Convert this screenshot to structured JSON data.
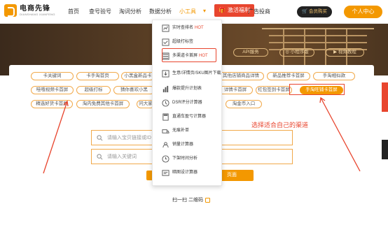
{
  "brand": {
    "name": "电商先锋",
    "sub": "DIANSHANG XIANFENG"
  },
  "nav": {
    "items": [
      "首页",
      "查号验号",
      "淘词分析",
      "数据分析",
      "小工具"
    ],
    "hot_label": "激活福利",
    "ads_label": "广告投商",
    "vip_label": "会员购买",
    "center_label": "个人中心"
  },
  "hero": {
    "buttons": [
      "API服务",
      "小程序版",
      "视频教程"
    ]
  },
  "tags": {
    "row1": [
      "卡关键词",
      "卡手淘首页",
      "小黑盒新品卡",
      "",
      "其他店铺商品详情",
      "新品推荐卡首屏",
      "手淘相似款"
    ],
    "row2": [
      "哇哦视频卡首屏",
      "超级打标",
      "猜你喜欢小黑",
      "",
      "详情卡首屏",
      "红包签到卡首屏",
      "手淘旺铺卡首屏"
    ],
    "row3": [
      "精选好货卡首屏",
      "淘内免费其他卡首屏",
      "问大家",
      "",
      "淘金币入口"
    ]
  },
  "search": {
    "placeholder1": "请输入宝贝链接或ID",
    "placeholder2": "请输入关键词",
    "generate_label": "页面",
    "qr_label": "扫一扫 二维码"
  },
  "annotation": "选择适合自己的渠道",
  "dropdown": {
    "items": [
      {
        "label": "实时查排名",
        "hot": "HOT",
        "icon": "rank-icon"
      },
      {
        "label": "超级打标签",
        "hot": "",
        "icon": "tag-icon"
      },
      {
        "label": "多渠道卡首屏",
        "hot": "HOT",
        "icon": "channel-icon"
      },
      {
        "label": "生意/详情页/SKU图片下载",
        "hot": "",
        "icon": "download-icon"
      },
      {
        "label": "爆款提升计划表",
        "hot": "",
        "icon": "chart-icon"
      },
      {
        "label": "DSR评分计算器",
        "hot": "",
        "icon": "dsr-icon"
      },
      {
        "label": "直通车盈亏计算器",
        "hot": "",
        "icon": "calculator-icon"
      },
      {
        "label": "无痕补单",
        "hot": "",
        "icon": "truck-icon"
      },
      {
        "label": "销量计算器",
        "hot": "",
        "icon": "sales-icon"
      },
      {
        "label": "下架时间分析",
        "hot": "",
        "icon": "clock-icon"
      },
      {
        "label": "暗图设计算器",
        "hot": "",
        "icon": "design-icon"
      }
    ]
  },
  "colors": {
    "accent": "#f39800",
    "alert": "#e8452e",
    "dark": "#222222"
  }
}
